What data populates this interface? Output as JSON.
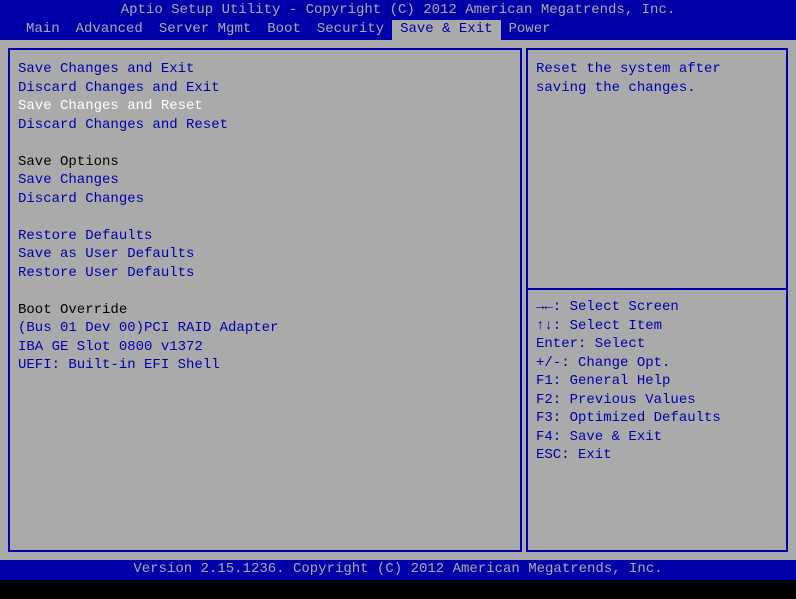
{
  "header": {
    "title": "Aptio Setup Utility - Copyright (C) 2012 American Megatrends, Inc."
  },
  "menu": {
    "items": [
      {
        "label": "Main",
        "selected": false
      },
      {
        "label": "Advanced",
        "selected": false
      },
      {
        "label": "Server Mgmt",
        "selected": false
      },
      {
        "label": "Boot",
        "selected": false
      },
      {
        "label": "Security",
        "selected": false
      },
      {
        "label": "Save & Exit",
        "selected": true
      },
      {
        "label": "Power",
        "selected": false
      }
    ]
  },
  "main": {
    "items": [
      {
        "type": "option",
        "label": "Save Changes and Exit",
        "selected": false
      },
      {
        "type": "option",
        "label": "Discard Changes and Exit",
        "selected": false
      },
      {
        "type": "option",
        "label": "Save Changes and Reset",
        "selected": true
      },
      {
        "type": "option",
        "label": "Discard Changes and Reset",
        "selected": false
      },
      {
        "type": "blank"
      },
      {
        "type": "header",
        "label": "Save Options"
      },
      {
        "type": "option",
        "label": "Save Changes",
        "selected": false
      },
      {
        "type": "option",
        "label": "Discard Changes",
        "selected": false
      },
      {
        "type": "blank"
      },
      {
        "type": "option",
        "label": "Restore Defaults",
        "selected": false
      },
      {
        "type": "option",
        "label": "Save as User Defaults",
        "selected": false
      },
      {
        "type": "option",
        "label": "Restore User Defaults",
        "selected": false
      },
      {
        "type": "blank"
      },
      {
        "type": "header",
        "label": "Boot Override"
      },
      {
        "type": "option",
        "label": "(Bus 01 Dev 00)PCI RAID Adapter",
        "selected": false
      },
      {
        "type": "option",
        "label": "IBA GE Slot 0800 v1372",
        "selected": false
      },
      {
        "type": "option",
        "label": "UEFI: Built-in EFI Shell",
        "selected": false
      }
    ]
  },
  "help": {
    "description": "Reset the system after saving the changes.",
    "keys": [
      "→←: Select Screen",
      "↑↓: Select Item",
      "Enter: Select",
      "+/-: Change Opt.",
      "F1: General Help",
      "F2: Previous Values",
      "F3: Optimized Defaults",
      "F4: Save & Exit",
      "ESC: Exit"
    ]
  },
  "footer": {
    "text": "Version 2.15.1236. Copyright (C) 2012 American Megatrends, Inc."
  }
}
